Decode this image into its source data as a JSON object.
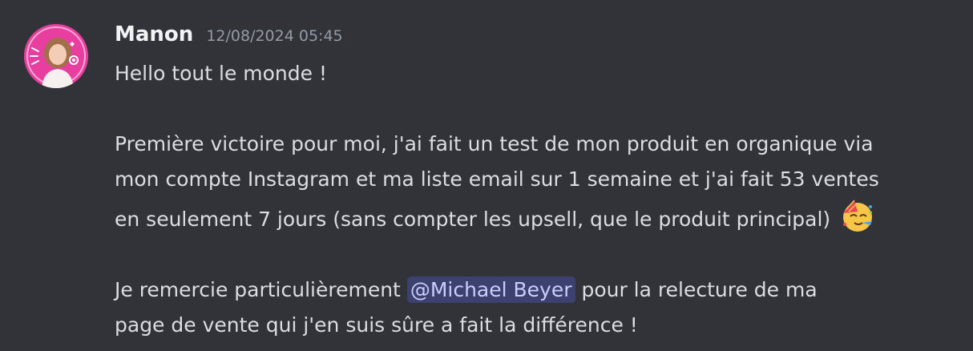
{
  "message": {
    "author": "Manon",
    "timestamp": "12/08/2024 05:45",
    "greeting": "Hello tout le monde !",
    "paragraph2": {
      "line1": "Première victoire pour moi, j'ai fait un test de mon produit en organique via",
      "line2": "mon compte Instagram et ma liste email sur 1 semaine et j'ai fait 53 ventes",
      "line3": "en seulement 7 jours (sans compter les upsell, que le produit principal)",
      "emoji": "partying-face-emoji"
    },
    "paragraph3": {
      "before_mention": "Je remercie particulièrement ",
      "mention": "@Michael Beyer",
      "after_mention": " pour la relecture de ma",
      "line2": "page de vente qui j'en suis sûre a fait la différence !"
    }
  },
  "colors": {
    "background": "#313338",
    "username": "#f2f3f5",
    "text": "#dbdee1",
    "timestamp": "#949ba4",
    "mention_bg": "#3c4270",
    "mention_text": "#c9cdfb",
    "avatar_bg": "#e83e9f"
  }
}
